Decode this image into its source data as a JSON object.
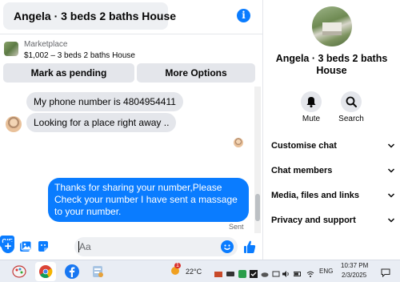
{
  "chat": {
    "title": "Angela · 3 beds 2 baths House",
    "marketplace": {
      "label": "Marketplace",
      "listing": "$1,002 – 3 beds 2 baths House"
    },
    "buttons": {
      "mark_pending": "Mark as pending",
      "more_options": "More Options"
    },
    "messages": [
      {
        "direction": "in",
        "text": "My phone number is 4804954411"
      },
      {
        "direction": "in",
        "text": "Looking for a place right away .."
      },
      {
        "direction": "out",
        "text": "Thanks for sharing your number,Please Check your number I have sent a massage to your number."
      }
    ],
    "sent_status": "Sent",
    "composer": {
      "placeholder": "Aa"
    }
  },
  "panel": {
    "title": "Angela · 3 beds 2 baths House",
    "actions": [
      {
        "label": "Mute",
        "icon": "bell-icon"
      },
      {
        "label": "Search",
        "icon": "search-icon"
      }
    ],
    "menu": [
      {
        "label": "Customise chat"
      },
      {
        "label": "Chat members"
      },
      {
        "label": "Media, files and links"
      },
      {
        "label": "Privacy and support"
      }
    ]
  },
  "taskbar": {
    "weather": {
      "temp": "22°C",
      "badge": "1"
    },
    "language": "ENG",
    "time": "10:37 PM",
    "date": "2/3/2025"
  },
  "colors": {
    "accent": "#0a7cff",
    "bubble_in": "#e4e6eb",
    "taskbar": "#e9edf4"
  }
}
